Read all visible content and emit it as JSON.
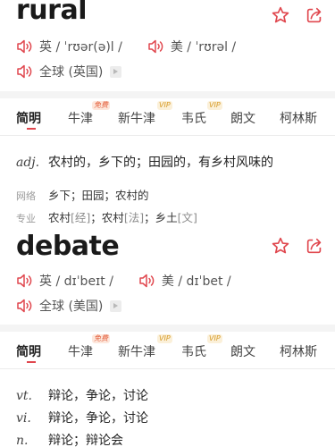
{
  "entries": [
    {
      "word": "rural",
      "pron_uk": "英 / ˈrʊər(ə)l /",
      "pron_us": "美 / ˈrʊrəl /",
      "pron_global": "全球 (英国)",
      "tabs": {
        "jianming": "简明",
        "niujin": "牛津",
        "xinniujin": "新牛津",
        "weishi": "韦氏",
        "langwen": "朗文",
        "kelinsi": "柯林斯",
        "badge_free": "免费",
        "badge_vip1": "VIP",
        "badge_vip2": "VIP"
      },
      "defs": [
        {
          "pos": "adj.",
          "meaning": "农村的，乡下的；田园的，有乡村风味的"
        }
      ],
      "web_label": "网络",
      "web_value": "乡下；田园；农村的",
      "pro_label": "专业",
      "pro_items": {
        "a": "农村",
        "a_tag": "[经]",
        "sep1": "；",
        "b": "农村",
        "b_tag": "[法]",
        "sep2": "；",
        "c": "乡土",
        "c_tag": "[文]"
      }
    },
    {
      "word": "debate",
      "pron_uk": "英 / dɪˈbeɪt /",
      "pron_us": "美 / dɪˈbet /",
      "pron_global": "全球 (美国)",
      "tabs": {
        "jianming": "简明",
        "niujin": "牛津",
        "xinniujin": "新牛津",
        "weishi": "韦氏",
        "langwen": "朗文",
        "kelinsi": "柯林斯",
        "badge_free": "免费",
        "badge_vip1": "VIP",
        "badge_vip2": "VIP"
      },
      "defs": [
        {
          "pos": "vt.",
          "meaning": "辩论，争论，讨论"
        },
        {
          "pos": "vi.",
          "meaning": "辩论，争论，讨论"
        },
        {
          "pos": "n.",
          "meaning": "辩论；辩论会"
        }
      ]
    }
  ],
  "icons": {
    "favorite": "star-icon",
    "share": "share-icon",
    "speaker": "speaker-icon",
    "arrow": "play-arrow-icon"
  },
  "colors": {
    "accent": "#e0474e",
    "vip": "#d79b27",
    "free": "#e35d3a"
  }
}
